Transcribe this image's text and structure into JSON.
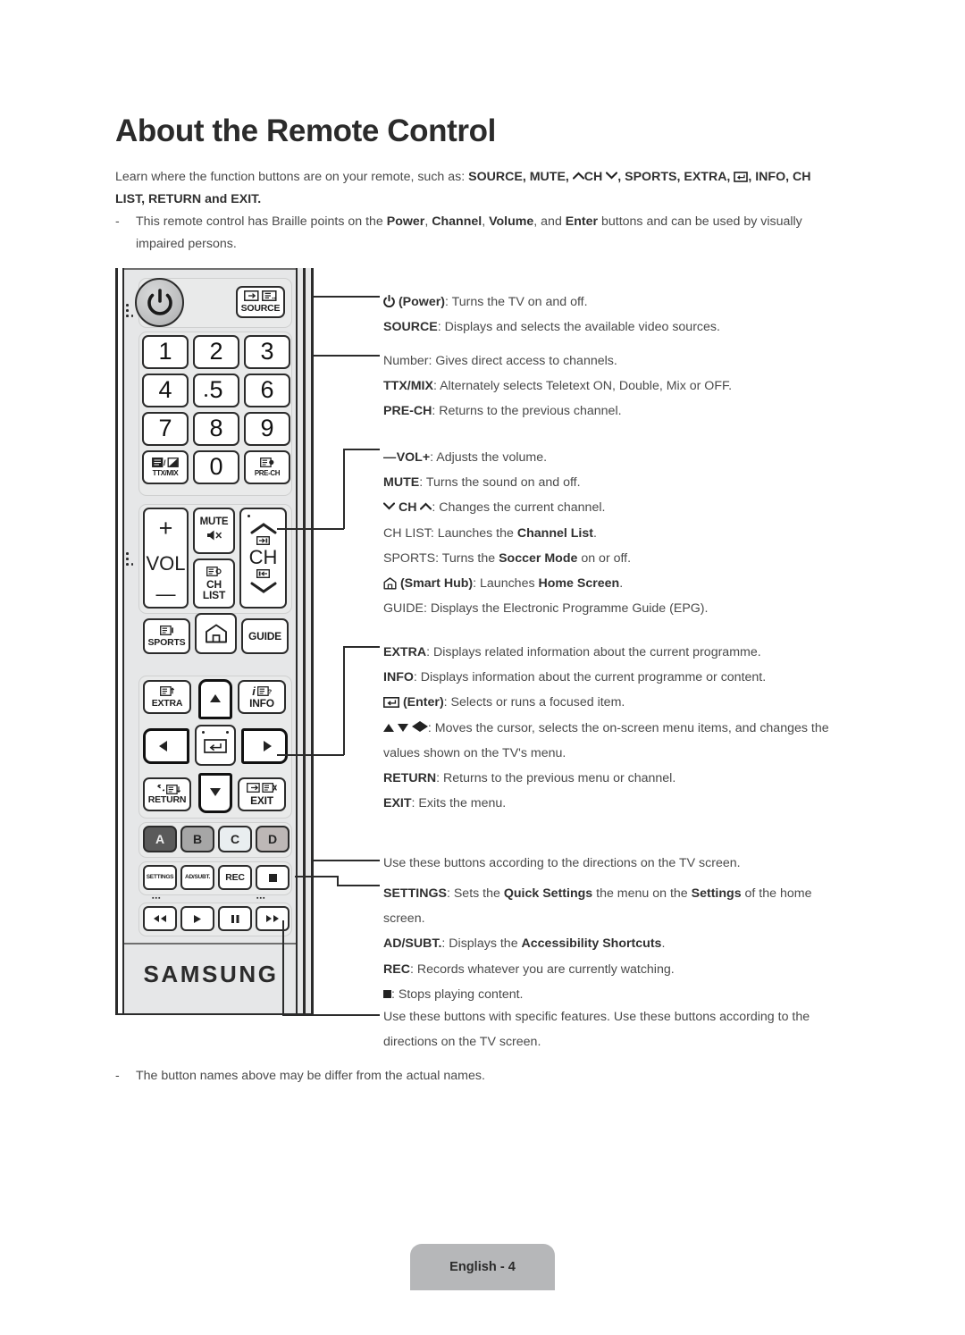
{
  "header": {
    "title": "About the Remote Control",
    "intro_prefix": "Learn where the function buttons are on your remote, such as: ",
    "intro_items": "SOURCE, MUTE,",
    "intro_ch": "CH",
    "intro_items2": ", SPORTS, EXTRA,",
    "intro_items3": ", INFO, CH LIST, RETURN and EXIT.",
    "bullet_dash": "-",
    "bullet_text_1": "This remote control has Braille points on the ",
    "bullet_b1": "Power",
    "bullet_sep1": ", ",
    "bullet_b2": "Channel",
    "bullet_sep2": ", ",
    "bullet_b3": "Volume",
    "bullet_sep3": ", and ",
    "bullet_b4": "Enter",
    "bullet_text_2": " buttons and can be used by visually impaired persons."
  },
  "note": {
    "dash": "-",
    "text": "The button names above may be differ from the actual names."
  },
  "footer": {
    "label": "English - 4"
  },
  "remote": {
    "brand": "SAMSUNG",
    "keys": {
      "power": "",
      "source": "SOURCE",
      "n1": "1",
      "n2": "2",
      "n3": "3",
      "n4": "4",
      "n5": "5",
      "n6": "6",
      "n7": "7",
      "n8": "8",
      "n9": "9",
      "n0": "0",
      "ttxmix": "TTX/MIX",
      "prech": "PRE-CH",
      "vol": "VOL",
      "volplus": "+",
      "volminus": "—",
      "mute": "MUTE",
      "chlist_l1": "CH",
      "chlist_l2": "LIST",
      "ch": "CH",
      "sports": "SPORTS",
      "smarthub": "",
      "guide": "GUIDE",
      "extra": "EXTRA",
      "info": "INFO",
      "info_i": "i",
      "return": "RETURN",
      "exit": "EXIT",
      "color_a": "A",
      "color_b": "B",
      "color_c": "C",
      "color_d": "D",
      "settings": "SETTINGS",
      "adsubt": "AD/SUBT.",
      "rec": "REC",
      "stop": "",
      "rew": "",
      "play": "",
      "pause": "",
      "ff": ""
    }
  },
  "descriptions": {
    "group_power": {
      "l1_glyph": "power-icon",
      "l1_b": "(Power)",
      "l1_rest": ": Turns the TV on and off.",
      "l2_b": "SOURCE",
      "l2_rest": ": Displays and selects the available video sources."
    },
    "group_numbers": {
      "l1_b": "Number",
      "l1_rest": ": Gives direct access to channels.",
      "l2_b": "TTX/MIX",
      "l2_rest": ": Alternately selects Teletext ON, Double, Mix or OFF.",
      "l3_b": "PRE-CH",
      "l3_rest": ": Returns to the previous channel."
    },
    "group_volch": {
      "l1_b": "VOL",
      "l1_rest": ": Adjusts the volume.",
      "l2_b": "MUTE",
      "l2_rest": ": Turns the sound on and off.",
      "l3_b": "CH",
      "l3_rest": ": Changes the current channel.",
      "l4_b": "CH LIST",
      "l4_mid": ": Launches the ",
      "l4_b2": "Channel List",
      "l4_end": ".",
      "l5_b": "SPORTS",
      "l5_mid": ": Turns the ",
      "l5_b2": "Soccer Mode",
      "l5_end": " on or off.",
      "l6_b": "(Smart Hub)",
      "l6_mid": ": Launches ",
      "l6_b2": "Home Screen",
      "l6_end": ".",
      "l7_b": "GUIDE",
      "l7_rest": ": Displays the Electronic Programme Guide (EPG)."
    },
    "group_dpad": {
      "l1_b": "EXTRA",
      "l1_rest": ": Displays related information about the current programme.",
      "l2_b": "INFO",
      "l2_rest": ": Displays information about the current programme or content.",
      "l3_b": "(Enter)",
      "l3_rest": ": Selects or runs a focused item.",
      "l4_rest": ": Moves the cursor, selects the on-screen menu items, and changes the values shown on the TV's menu.",
      "l5_b": "RETURN",
      "l5_rest": ": Returns to the previous menu or channel.",
      "l6_b": "EXIT",
      "l6_rest": ": Exits the menu."
    },
    "group_colors": {
      "l1": "Use these buttons according to the directions on the TV screen."
    },
    "group_settings": {
      "l1_b": "SETTINGS",
      "l1_mid": ": Sets the ",
      "l1_b2": "Quick Settings",
      "l1_mid2": " the menu on the ",
      "l1_b3": "Settings",
      "l1_end": " of the home screen.",
      "l2_b": "AD/SUBT.",
      "l2_mid": ": Displays the ",
      "l2_b2": "Accessibility Shortcuts",
      "l2_end": ".",
      "l3_b": "REC",
      "l3_rest": ": Records whatever you are currently watching.",
      "l4_rest": ": Stops playing content."
    },
    "group_media": {
      "l1": "Use these buttons with specific features. Use these buttons according to the directions on the TV screen."
    }
  }
}
